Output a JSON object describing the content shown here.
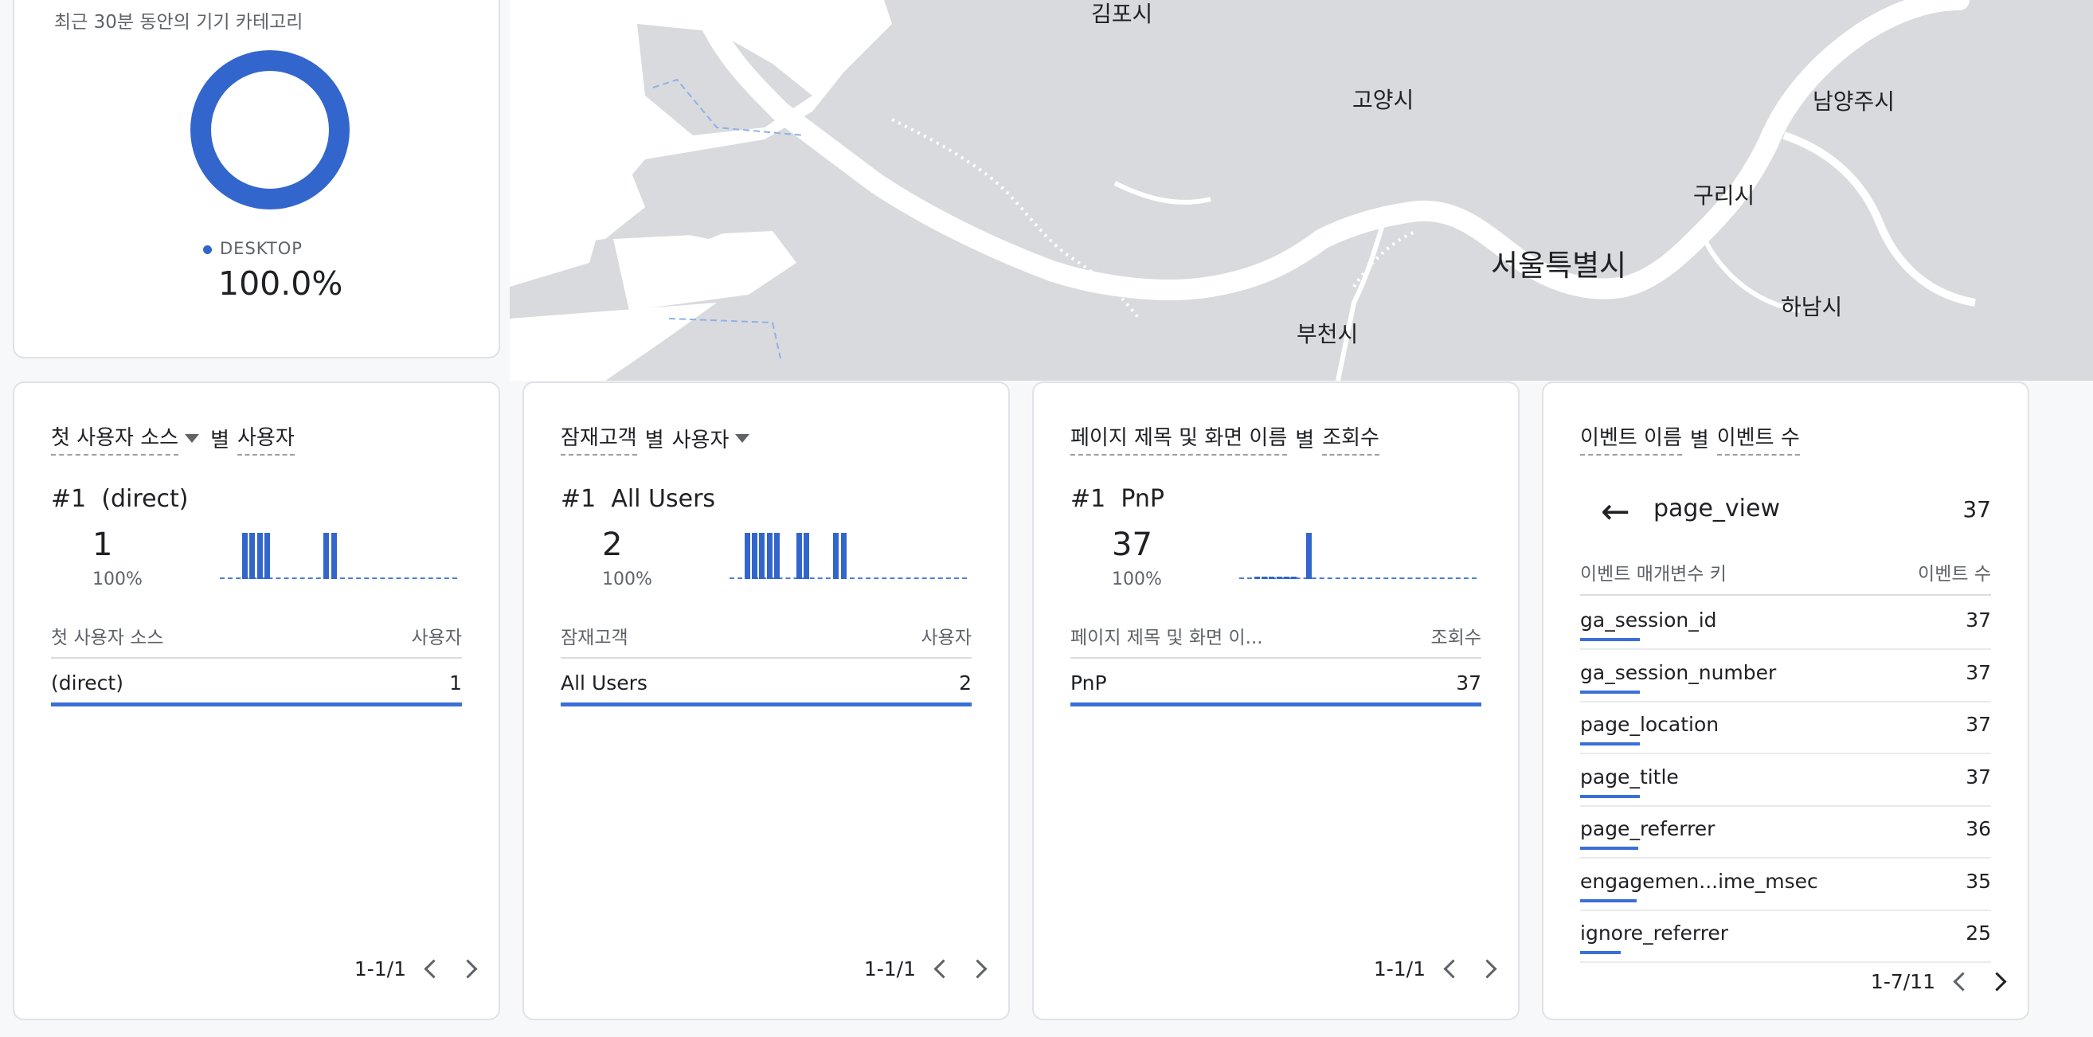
{
  "colors": {
    "accent": "#3366cc",
    "map_land": "#d9dadd",
    "map_water": "#ffffff"
  },
  "map": {
    "labels": {
      "gimpo": "김포시",
      "goyang": "고양시",
      "namyangju": "남양주시",
      "guri": "구리시",
      "seoul": "서울특별시",
      "hanam": "하남시",
      "bucheon": "부천시"
    }
  },
  "device_card": {
    "title": "최근 30분 동안의 기기 카테고리",
    "legend_label": "DESKTOP",
    "legend_value": "100.0%",
    "share": 1.0
  },
  "cards": [
    {
      "title_dim": "첫 사용자 소스",
      "title_by": "별",
      "title_metric": "사용자",
      "rank": "#1",
      "rank_name": "(direct)",
      "value": "1",
      "percent": "100%",
      "spark": [
        0,
        0,
        0,
        1,
        1,
        1,
        1,
        0,
        0,
        0,
        0,
        0,
        0,
        0,
        1,
        1,
        0,
        0,
        0,
        0,
        0,
        0,
        0,
        0,
        0,
        0,
        0,
        0,
        0,
        0,
        0,
        0
      ],
      "col_left": "첫 사용자 소스",
      "col_right": "사용자",
      "row_label": "(direct)",
      "row_value": "1",
      "pager": "1-1/1"
    },
    {
      "title_dim": "잠재고객",
      "title_by": "별",
      "title_metric": "사용자",
      "rank": "#1",
      "rank_name": "All Users",
      "value": "2",
      "percent": "100%",
      "spark": [
        0,
        0,
        1,
        1,
        1,
        1,
        1,
        0,
        0,
        1,
        1,
        0,
        0,
        0,
        1,
        1,
        0,
        0,
        0,
        0,
        0,
        0,
        0,
        0,
        0,
        0,
        0,
        0,
        0,
        0,
        0,
        0
      ],
      "col_left": "잠재고객",
      "col_right": "사용자",
      "row_label": "All Users",
      "row_value": "2",
      "pager": "1-1/1"
    },
    {
      "title_dim": "페이지 제목 및 화면 이름",
      "title_by": "별",
      "title_metric": "조회수",
      "rank": "#1",
      "rank_name": "PnP",
      "value": "37",
      "percent": "100%",
      "spark": [
        0,
        0,
        0.04,
        0.06,
        0.06,
        0.02,
        0.05,
        0.02,
        0,
        1,
        0,
        0,
        0,
        0,
        0,
        0,
        0,
        0,
        0,
        0,
        0,
        0,
        0,
        0,
        0,
        0,
        0,
        0,
        0,
        0,
        0,
        0
      ],
      "col_left": "페이지 제목 및 화면 이...",
      "col_right": "조회수",
      "row_label": "PnP",
      "row_value": "37",
      "pager": "1-1/1"
    }
  ],
  "event_card": {
    "title_dim": "이벤트 이름",
    "title_by": "별",
    "title_metric": "이벤트 수",
    "back_icon": "←",
    "event_name": "page_view",
    "event_count": "37",
    "col_left": "이벤트 매개변수 키",
    "col_right": "이벤트 수",
    "rows": [
      {
        "key": "ga_session_id",
        "value": "37"
      },
      {
        "key": "ga_session_number",
        "value": "37"
      },
      {
        "key": "page_location",
        "value": "37"
      },
      {
        "key": "page_title",
        "value": "37"
      },
      {
        "key": "page_referrer",
        "value": "36"
      },
      {
        "key": "engagemen...ime_msec",
        "value": "35"
      },
      {
        "key": "ignore_referrer",
        "value": "25"
      }
    ],
    "pager": "1-7/11"
  }
}
